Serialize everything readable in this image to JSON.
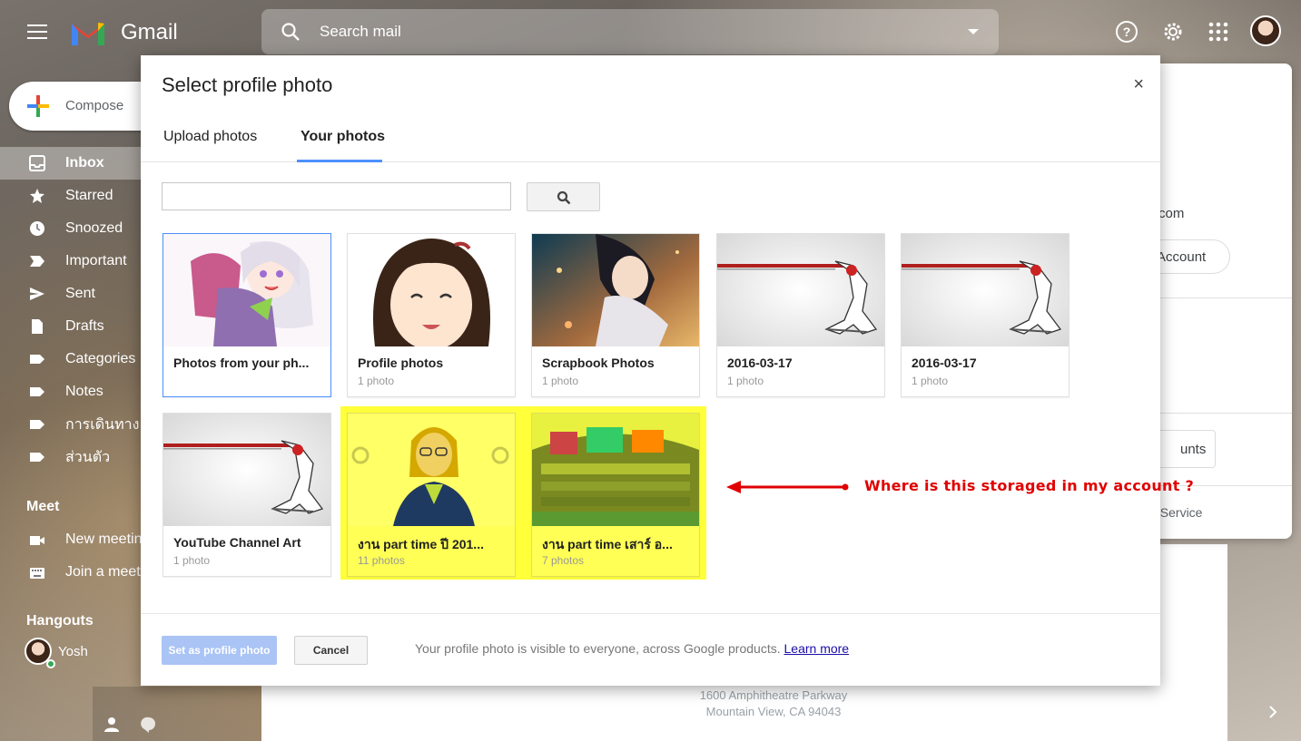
{
  "app": {
    "brand": "Gmail",
    "search_placeholder": "Search mail"
  },
  "compose": {
    "label": "Compose"
  },
  "sidebar": {
    "items": [
      {
        "label": "Inbox",
        "icon": "inbox-icon",
        "active": true
      },
      {
        "label": "Starred",
        "icon": "star-icon"
      },
      {
        "label": "Snoozed",
        "icon": "clock-icon"
      },
      {
        "label": "Important",
        "icon": "important-icon"
      },
      {
        "label": "Sent",
        "icon": "send-icon"
      },
      {
        "label": "Drafts",
        "icon": "draft-icon"
      },
      {
        "label": "Categories",
        "icon": "label-icon"
      },
      {
        "label": "Notes",
        "icon": "label-icon"
      },
      {
        "label": "การเดินทาง",
        "icon": "label-icon"
      },
      {
        "label": "ส่วนตัว",
        "icon": "label-icon"
      }
    ],
    "meet_title": "Meet",
    "meet_items": [
      {
        "label": "New meetin",
        "icon": "video-icon"
      },
      {
        "label": "Join a meet",
        "icon": "keyboard-icon"
      }
    ],
    "hangouts_title": "Hangouts",
    "hangouts_user": "Yosh"
  },
  "account_card": {
    "email_fragment": "com",
    "manage_button": "Account",
    "accounts_button": "unts",
    "terms_fragment": "f Service"
  },
  "footer": {
    "address_line1": "1600 Amphitheatre Parkway",
    "address_line2": "Mountain View, CA 94043"
  },
  "modal": {
    "title": "Select profile photo",
    "close": "×",
    "tabs": [
      {
        "label": "Upload photos",
        "active": false
      },
      {
        "label": "Your photos",
        "active": true
      }
    ],
    "search_value": "",
    "albums": [
      {
        "title": "Photos from your ph...",
        "count": "",
        "selected": true
      },
      {
        "title": "Profile photos",
        "count": "1 photo"
      },
      {
        "title": "Scrapbook Photos",
        "count": "1 photo"
      },
      {
        "title": "2016-03-17",
        "count": "1 photo"
      },
      {
        "title": "2016-03-17",
        "count": "1 photo"
      },
      {
        "title": "YouTube Channel Art",
        "count": "1 photo"
      },
      {
        "title": "งาน part time ปี 201...",
        "count": "11 photos",
        "highlighted": true
      },
      {
        "title": "งาน part time เสาร์ อ...",
        "count": "7 photos",
        "highlighted": true
      }
    ],
    "set_button": "Set as profile photo",
    "cancel_button": "Cancel",
    "note": "Your profile photo is visible to everyone, across Google products.",
    "learn_more": "Learn more"
  },
  "annotation": {
    "text": "Where is this storaged in my account ?",
    "color": "#e00000"
  },
  "colors": {
    "accent": "#4d90fe",
    "highlight": "#ffff3a",
    "primary_button": "#a9c4f5"
  }
}
